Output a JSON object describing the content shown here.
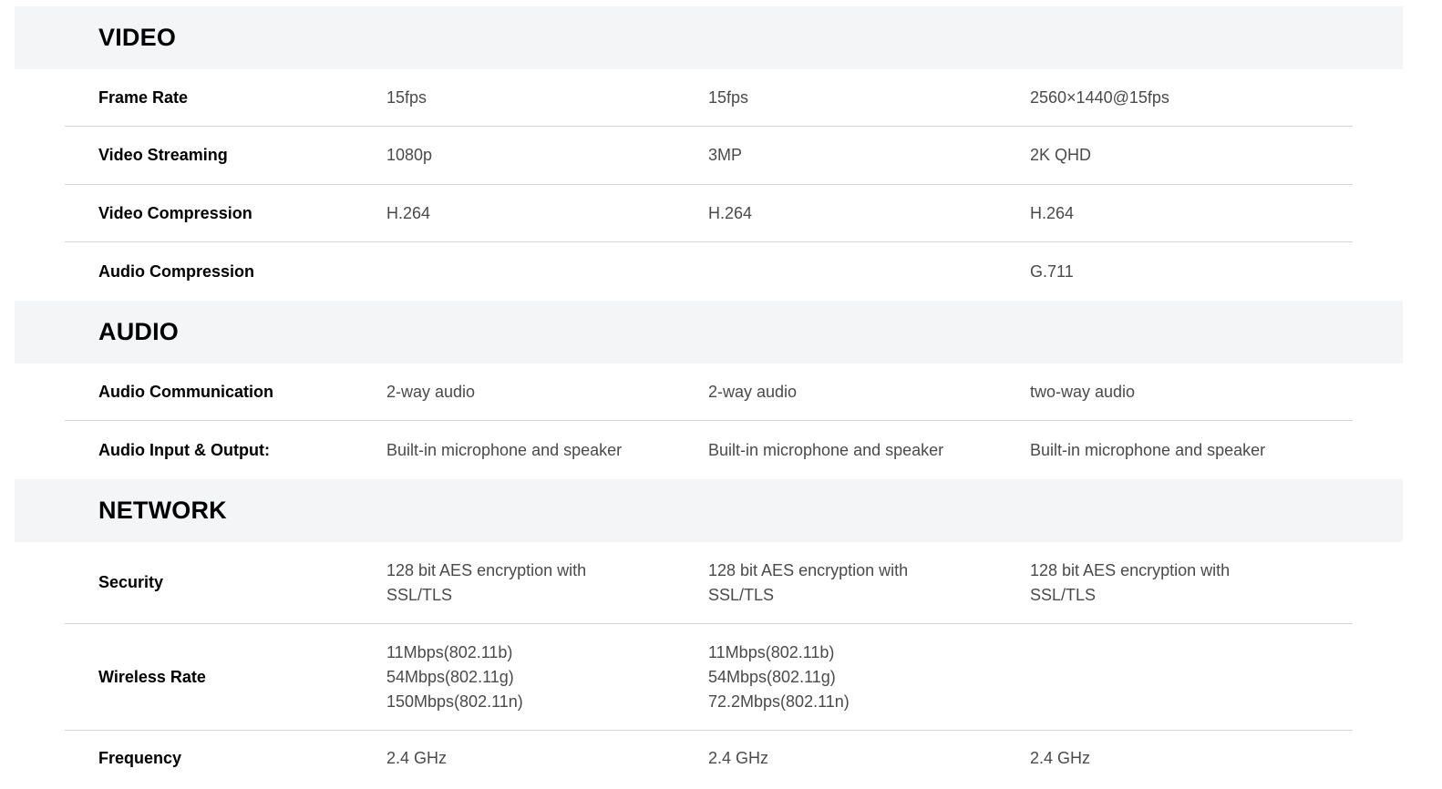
{
  "sections": [
    {
      "title": "VIDEO",
      "rows": [
        {
          "label": "Frame Rate",
          "values": [
            "15fps",
            "15fps",
            "2560×1440@15fps"
          ]
        },
        {
          "label": "Video Streaming",
          "values": [
            "1080p",
            "3MP",
            "2K QHD"
          ]
        },
        {
          "label": "Video Compression",
          "values": [
            "H.264",
            "H.264",
            "H.264"
          ]
        },
        {
          "label": "Audio Compression",
          "values": [
            "",
            "",
            "G.711"
          ]
        }
      ]
    },
    {
      "title": "AUDIO",
      "rows": [
        {
          "label": "Audio Communication",
          "values": [
            "2-way audio",
            "2-way audio",
            "two-way audio"
          ]
        },
        {
          "label": "Audio Input & Output:",
          "values": [
            "Built-in microphone and speaker",
            "Built-in microphone and speaker",
            "Built-in microphone and speaker"
          ]
        }
      ]
    },
    {
      "title": "NETWORK",
      "rows": [
        {
          "label": "Security",
          "values": [
            "128 bit AES encryption with\nSSL/TLS",
            "128 bit AES encryption with\nSSL/TLS",
            "128 bit AES encryption with\nSSL/TLS"
          ]
        },
        {
          "label": "Wireless Rate",
          "values": [
            "11Mbps(802.11b)\n54Mbps(802.11g)\n150Mbps(802.11n)",
            "11Mbps(802.11b)\n54Mbps(802.11g)\n72.2Mbps(802.11n)",
            ""
          ]
        },
        {
          "label": "Frequency",
          "values": [
            "2.4 GHz",
            "2.4 GHz",
            "2.4 GHz"
          ]
        }
      ]
    }
  ]
}
